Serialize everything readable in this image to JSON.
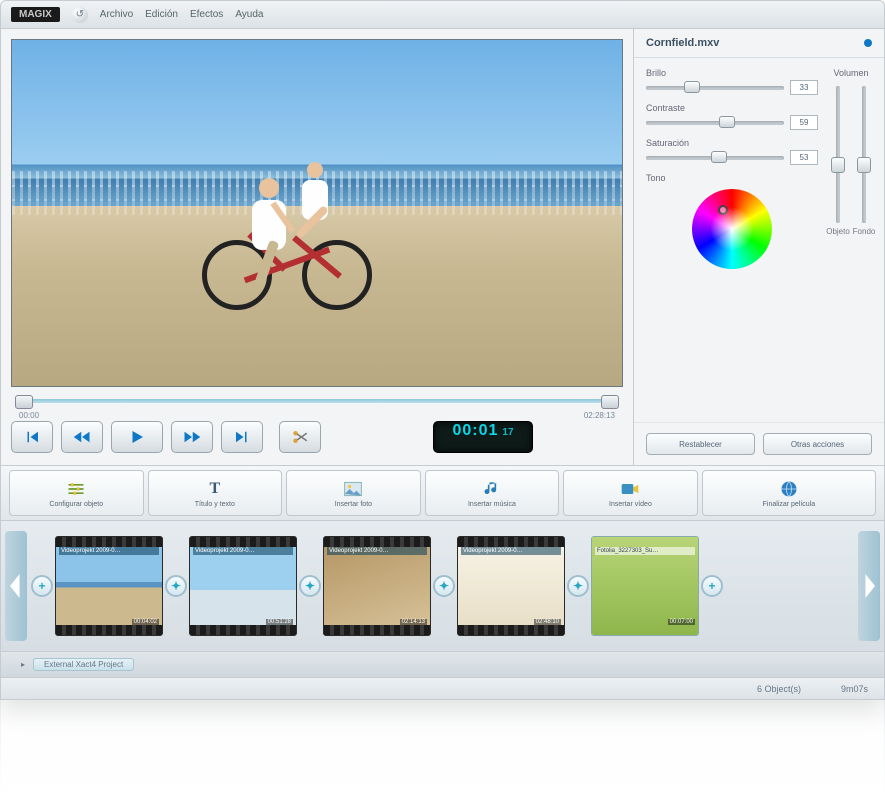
{
  "brand": "MAGIX",
  "menu": {
    "archivo": "Archivo",
    "edicion": "Edición",
    "efectos": "Efectos",
    "ayuda": "Ayuda"
  },
  "preview": {
    "ruler_start": "00:00",
    "ruler_end": "02:28:13"
  },
  "transport": {
    "time_main": "00:01",
    "time_frac": "17"
  },
  "panel": {
    "title": "Cornfield.mxv",
    "brillo": {
      "label": "Brillo",
      "value": "33",
      "pct": 33
    },
    "contraste": {
      "label": "Contraste",
      "value": "59",
      "pct": 59
    },
    "saturacion": {
      "label": "Saturación",
      "value": "53",
      "pct": 53
    },
    "tono": "Tono",
    "volumen": "Volumen",
    "vol_obj": {
      "label": "Objeto",
      "pct": 45
    },
    "vol_fondo": {
      "label": "Fondo",
      "pct": 45
    },
    "restablecer": "Restablecer",
    "otras": "Otras acciones"
  },
  "tools": {
    "config": "Configurar objeto",
    "title": "Título y texto",
    "foto": "Insertar foto",
    "musica": "Insertar música",
    "video": "Insertar vídeo",
    "finalizar": "Finalizar película"
  },
  "clips": [
    {
      "label": "Videoprojekt 2009-0…",
      "time": "00:04:02"
    },
    {
      "label": "Videoprojekt 2009-0…",
      "time": "00:51:28"
    },
    {
      "label": "Videoprojekt 2009-0…",
      "time": "02:14:13"
    },
    {
      "label": "Videoprojekt 2009-0…",
      "time": "02:48:10"
    },
    {
      "label": "Fotolia_3227303_Su…",
      "time": "00:07:00"
    }
  ],
  "trans_glyph": "✦",
  "add_glyph": "+",
  "project_name": "External Xact4 Project",
  "status": {
    "objects": "6 Object(s)",
    "duration": "9m07s"
  }
}
